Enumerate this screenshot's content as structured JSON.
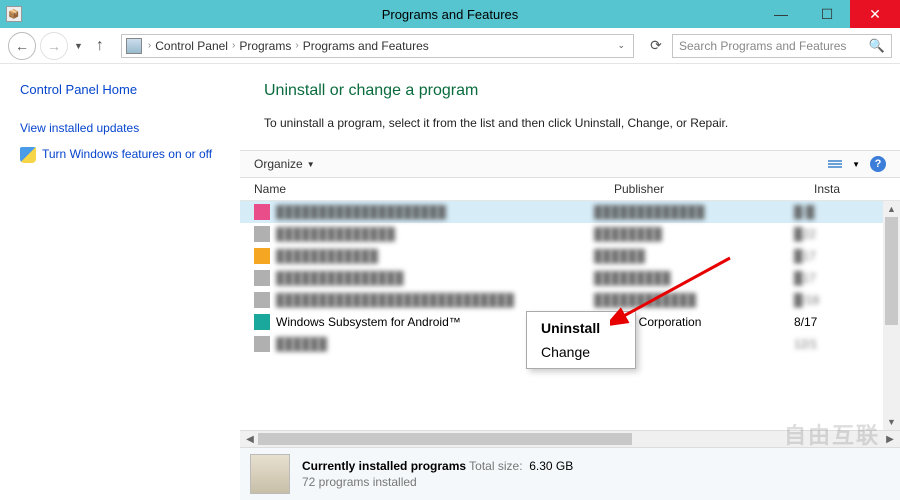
{
  "window": {
    "title": "Programs and Features"
  },
  "breadcrumbs": [
    "Control Panel",
    "Programs",
    "Programs and Features"
  ],
  "search": {
    "placeholder": "Search Programs and Features"
  },
  "sidebar": {
    "home": "Control Panel Home",
    "links": [
      "View installed updates",
      "Turn Windows features on or off"
    ]
  },
  "page": {
    "heading": "Uninstall or change a program",
    "sub": "To uninstall a program, select it from the list and then click Uninstall, Change, or Repair."
  },
  "toolbar": {
    "organize": "Organize"
  },
  "columns": {
    "name": "Name",
    "publisher": "Publisher",
    "installed": "Insta"
  },
  "rows": [
    {
      "icon": "ic-pink",
      "name": "████████████████████",
      "publisher": "█████████████",
      "installed": "█/█",
      "blurred": true,
      "selected": true
    },
    {
      "icon": "ic-gray",
      "name": "██████████████",
      "publisher": "████████",
      "installed": "█22",
      "blurred": true
    },
    {
      "icon": "ic-orange",
      "name": "████████████",
      "publisher": "██████",
      "installed": "█17",
      "blurred": true
    },
    {
      "icon": "ic-gray",
      "name": "███████████████",
      "publisher": "█████████",
      "installed": "█17",
      "blurred": true
    },
    {
      "icon": "ic-gray",
      "name": "████████████████████████████",
      "publisher": "████████████",
      "installed": "█/18",
      "blurred": true
    },
    {
      "icon": "ic-teal",
      "name": "Windows Subsystem for Android™",
      "publisher": "licrosoft Corporation",
      "installed": "8/17",
      "blurred": false
    },
    {
      "icon": "ic-gray",
      "name": "██████",
      "publisher": "",
      "installed": "12/1",
      "blurred": true
    }
  ],
  "context_menu": {
    "items": [
      "Uninstall",
      "Change"
    ]
  },
  "status": {
    "title": "Currently installed programs",
    "total_label": "Total size:",
    "total_size": "6.30 GB",
    "count": "72 programs installed"
  },
  "watermark": "自由互联"
}
